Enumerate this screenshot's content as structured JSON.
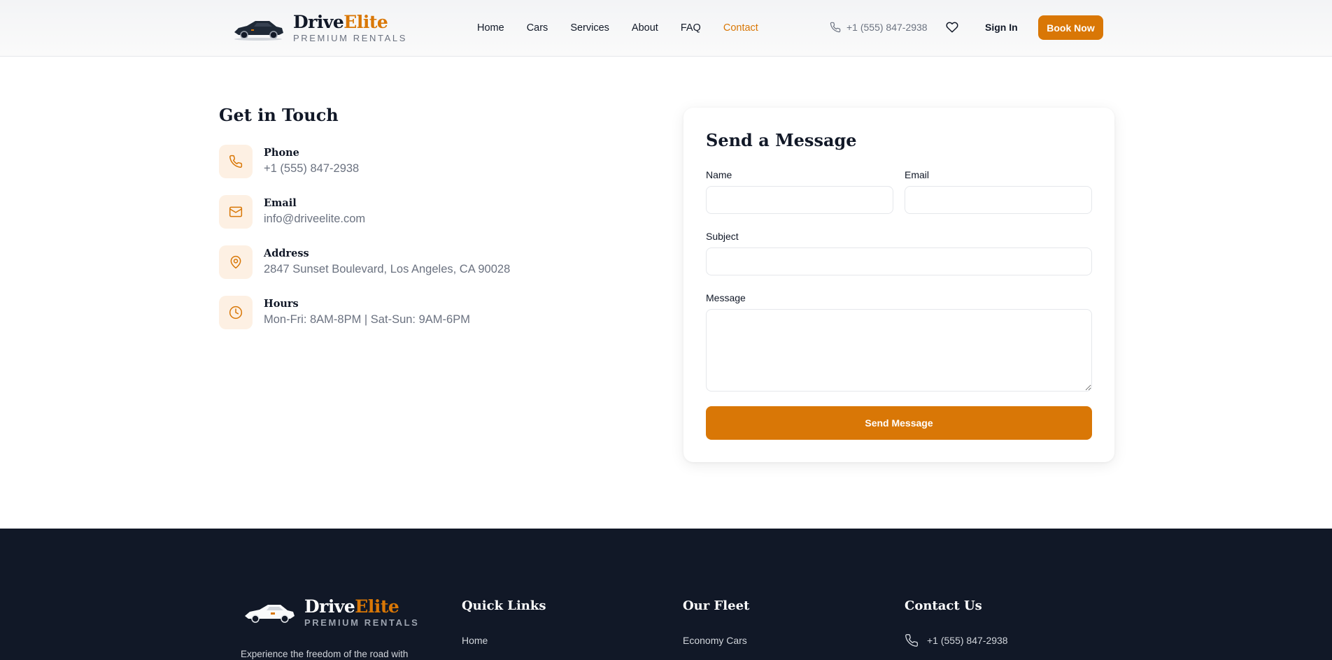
{
  "brand": {
    "name_main": "Drive",
    "name_accent": "Elite",
    "tagline": "PREMIUM RENTALS",
    "accent_color": "#d97706",
    "footer_bg": "#111827"
  },
  "header": {
    "nav": [
      "Home",
      "Cars",
      "Services",
      "About",
      "FAQ",
      "Contact"
    ],
    "active_nav": "Contact",
    "phone": "+1 (555) 847-2938",
    "signin": "Sign In",
    "book_now": "Book Now"
  },
  "contact_info": {
    "title": "Get in Touch",
    "items": [
      {
        "label": "Phone",
        "value": "+1 (555) 847-2938",
        "icon": "phone-icon"
      },
      {
        "label": "Email",
        "value": "info@driveelite.com",
        "icon": "mail-icon"
      },
      {
        "label": "Address",
        "value": "2847 Sunset Boulevard, Los Angeles, CA 90028",
        "icon": "map-pin-icon"
      },
      {
        "label": "Hours",
        "value": "Mon-Fri: 8AM-8PM | Sat-Sun: 9AM-6PM",
        "icon": "clock-icon"
      }
    ]
  },
  "form": {
    "title": "Send a Message",
    "name_label": "Name",
    "name_value": "",
    "email_label": "Email",
    "email_value": "",
    "subject_label": "Subject",
    "subject_value": "",
    "message_label": "Message",
    "message_value": "",
    "submit": "Send Message"
  },
  "footer": {
    "description": "Experience the freedom of the road with",
    "quick_links_title": "Quick Links",
    "quick_links": [
      "Home"
    ],
    "fleet_title": "Our Fleet",
    "fleet_links": [
      "Economy Cars"
    ],
    "contact_title": "Contact Us",
    "contact_phone": "+1 (555) 847-2938"
  }
}
